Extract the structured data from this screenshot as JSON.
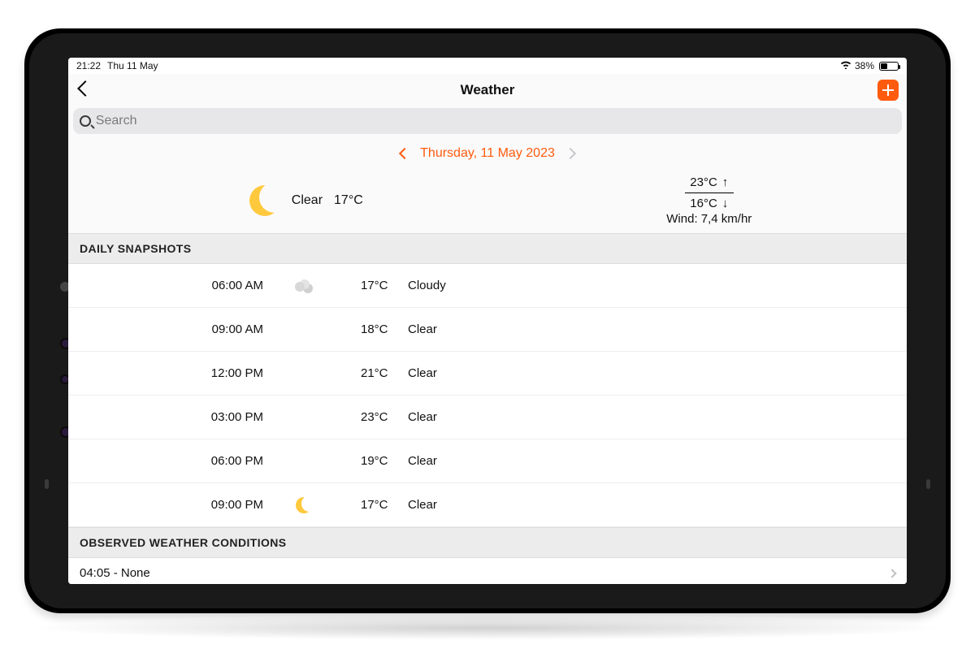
{
  "status": {
    "time": "21:22",
    "date": "Thu 11 May",
    "battery_pct": "38%"
  },
  "header": {
    "title": "Weather"
  },
  "search": {
    "placeholder": "Search"
  },
  "date_nav": {
    "label": "Thursday, 11 May 2023"
  },
  "summary": {
    "condition": "Clear",
    "temp": "17°C",
    "high": "23°C",
    "low": "16°C",
    "wind": "Wind: 7,4 km/hr"
  },
  "sections": {
    "snapshots": "DAILY SNAPSHOTS",
    "observed": "OBSERVED WEATHER CONDITIONS"
  },
  "snapshots": [
    {
      "time": "06:00 AM",
      "icon": "cloudy",
      "temp": "17°C",
      "cond": "Cloudy"
    },
    {
      "time": "09:00 AM",
      "icon": "",
      "temp": "18°C",
      "cond": "Clear"
    },
    {
      "time": "12:00 PM",
      "icon": "",
      "temp": "21°C",
      "cond": "Clear"
    },
    {
      "time": "03:00 PM",
      "icon": "",
      "temp": "23°C",
      "cond": "Clear"
    },
    {
      "time": "06:00 PM",
      "icon": "",
      "temp": "19°C",
      "cond": "Clear"
    },
    {
      "time": "09:00 PM",
      "icon": "moon",
      "temp": "17°C",
      "cond": "Clear"
    }
  ],
  "observed": {
    "row": "04:05 - None"
  }
}
